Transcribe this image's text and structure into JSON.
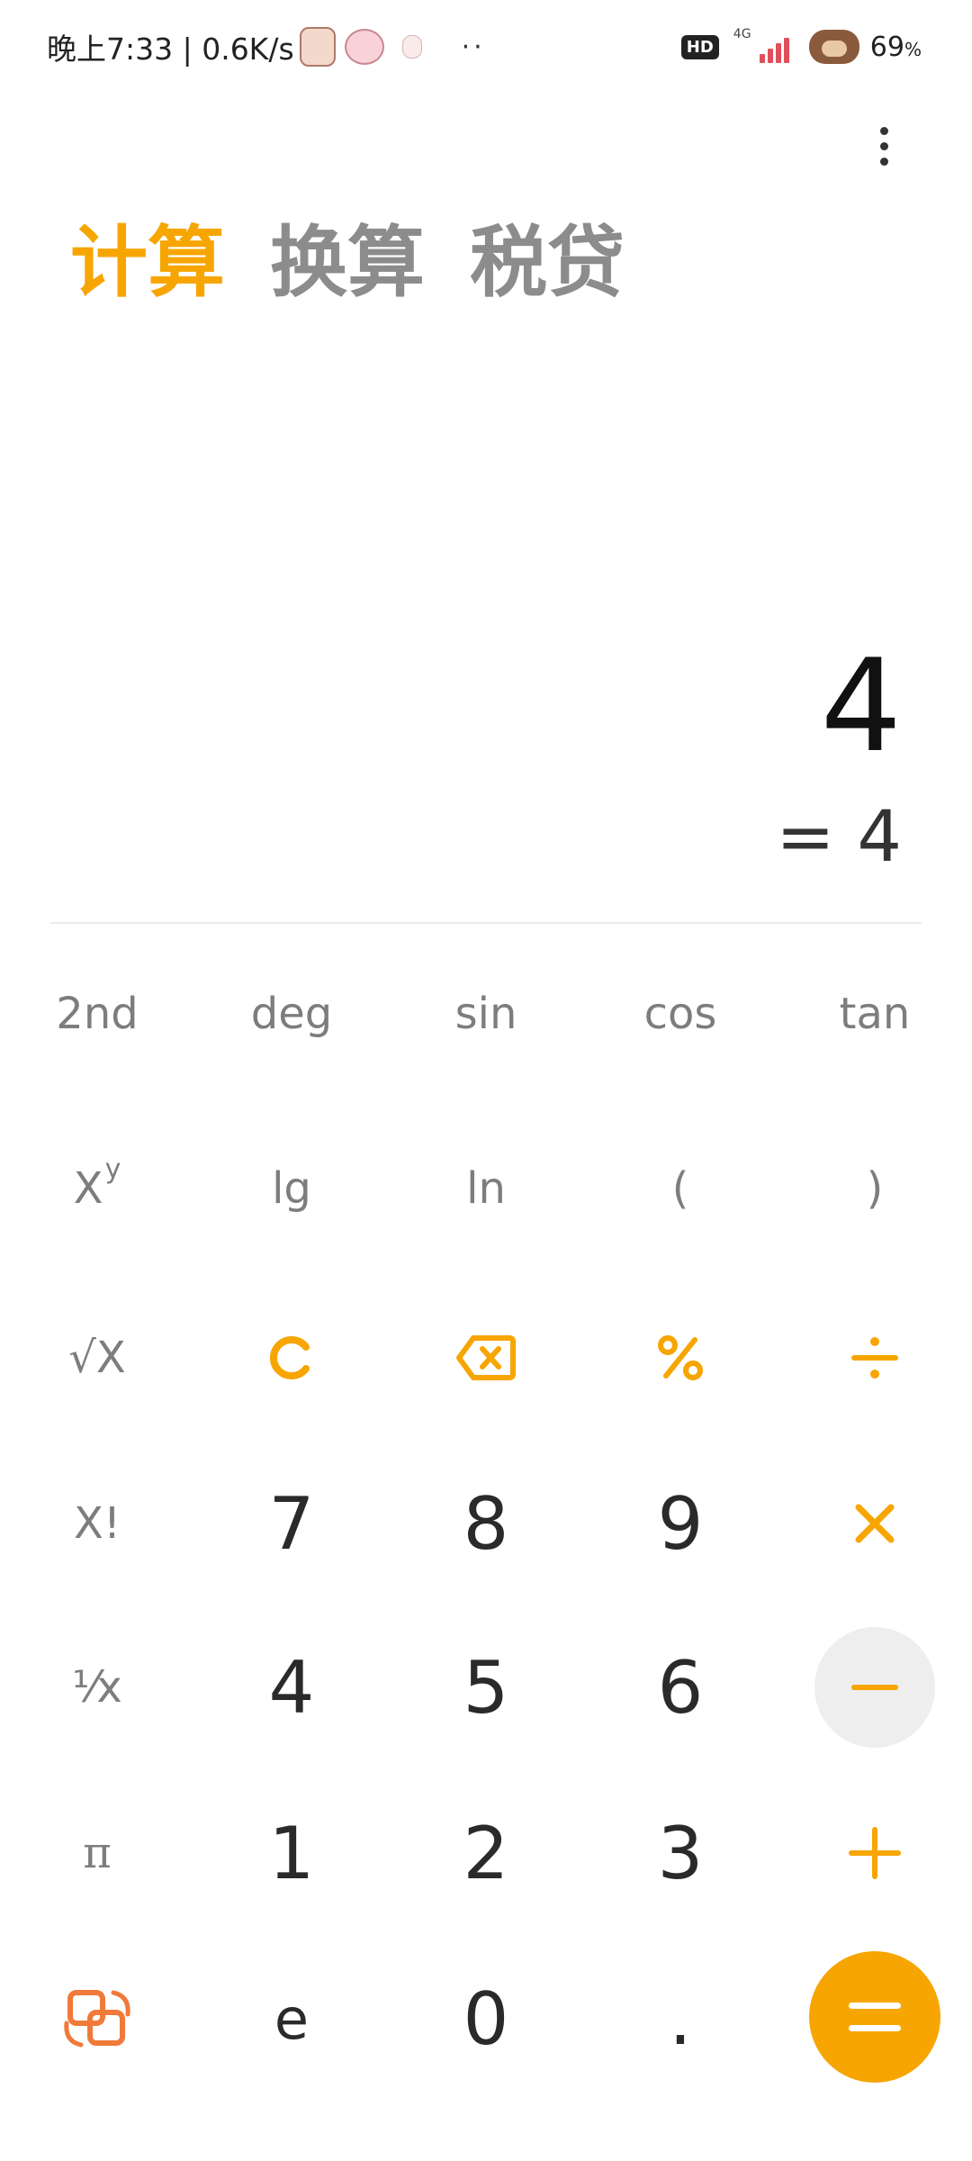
{
  "status_bar": {
    "time_speed": "晚上7:33 | 0.6K/s",
    "dots": "··",
    "hd": "HD",
    "network": "4G",
    "battery": "69",
    "battery_unit": "%"
  },
  "tabs": [
    {
      "label": "计算",
      "active": true
    },
    {
      "label": "换算",
      "active": false
    },
    {
      "label": "税贷",
      "active": false
    }
  ],
  "display": {
    "expression": "4",
    "result": "= 4"
  },
  "keys": {
    "second": "2nd",
    "deg": "deg",
    "sin": "sin",
    "cos": "cos",
    "tan": "tan",
    "power_base": "X",
    "power_exp": "y",
    "lg": "lg",
    "ln": "ln",
    "paren_open": "(",
    "paren_close": ")",
    "sqrt": "√X",
    "factorial": "X!",
    "reciprocal": "¹⁄x",
    "pi": "π",
    "e": "e",
    "dot": ".",
    "n0": "0",
    "n1": "1",
    "n2": "2",
    "n3": "3",
    "n4": "4",
    "n5": "5",
    "n6": "6",
    "n7": "7",
    "n8": "8",
    "n9": "9"
  },
  "colors": {
    "accent": "#f7a500",
    "tab_inactive": "#8c8c8c",
    "switch_icon": "#f07a3a",
    "minus_bg": "#eeeeee"
  },
  "icons": {
    "more": "more-vertical-icon",
    "clear": "clear-icon",
    "backspace": "backspace-icon",
    "percent": "percent-icon",
    "divide": "divide-icon",
    "multiply": "multiply-icon",
    "minus": "minus-icon",
    "plus": "plus-icon",
    "equals": "equals-icon",
    "switch": "switch-mode-icon"
  }
}
